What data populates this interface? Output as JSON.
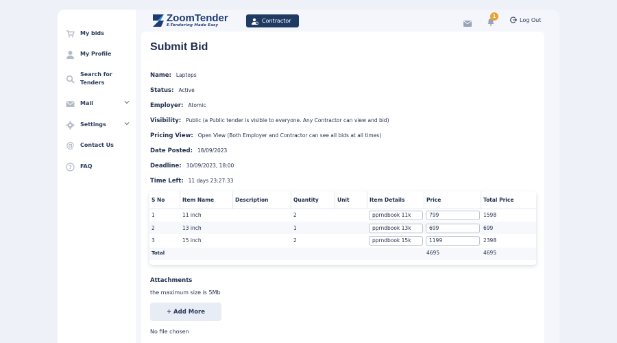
{
  "brand": {
    "name_dark": "Zoom",
    "name_light": "Tender",
    "tagline": "E-Tendering Made Easy",
    "primary_color": "#1f3b73",
    "accent_color": "#2d9cdb"
  },
  "header": {
    "role_label": "Contractor",
    "notification_count": "1",
    "logout_label": "Log Out"
  },
  "sidebar": {
    "items": [
      {
        "label": "My bids",
        "icon": "cart-icon"
      },
      {
        "label": "My Profile",
        "icon": "user-icon"
      },
      {
        "label": "Search for Tenders",
        "icon": "search-icon"
      },
      {
        "label": "Mail",
        "icon": "mail-icon",
        "expandable": true
      },
      {
        "label": "Settings",
        "icon": "gear-icon",
        "expandable": true
      },
      {
        "label": "Contact Us",
        "icon": "at-icon"
      },
      {
        "label": "FAQ",
        "icon": "help-icon"
      }
    ]
  },
  "page": {
    "title": "Submit Bid",
    "fields": [
      {
        "key": "Name:",
        "value": "Laptops"
      },
      {
        "key": "Status:",
        "value": "Active"
      },
      {
        "key": "Employer:",
        "value": "Atomic"
      },
      {
        "key": "Visibility:",
        "value": "Public (a Public tender is visible to everyone. Any Contractor can view and bid)"
      },
      {
        "key": "Pricing View:",
        "value": "Open View (Both Employer and Contractor can see all bids at all times)"
      },
      {
        "key": "Date Posted:",
        "value": "18/09/2023"
      },
      {
        "key": "Deadline:",
        "value": "30/09/2023, 18:00"
      },
      {
        "key": "Time Left:",
        "value": "11 days 23:27:33"
      }
    ]
  },
  "table": {
    "headers": [
      "S No",
      "Item Name",
      "Description",
      "Quantity",
      "Unit",
      "Item Details",
      "Price",
      "Total Price"
    ],
    "rows": [
      {
        "sno": "1",
        "item": "11 inch",
        "description": "",
        "quantity": "2",
        "unit": "",
        "details": "pprndbook 11k",
        "price": "799",
        "total": "1598"
      },
      {
        "sno": "2",
        "item": "13 inch",
        "description": "",
        "quantity": "1",
        "unit": "",
        "details": "pprndbook 13k",
        "price": "699",
        "total": "699"
      },
      {
        "sno": "3",
        "item": "15 inch",
        "description": "",
        "quantity": "2",
        "unit": "",
        "details": "pprndbook 15k",
        "price": "1199",
        "total": "2398"
      }
    ],
    "total_label": "Total",
    "total_price": "4695",
    "grand_total": "4695"
  },
  "attachments": {
    "title": "Attachments",
    "note": "the maximum size is 5Mb",
    "add_more_label": "+ Add More",
    "no_file_label": "No file chosen"
  }
}
